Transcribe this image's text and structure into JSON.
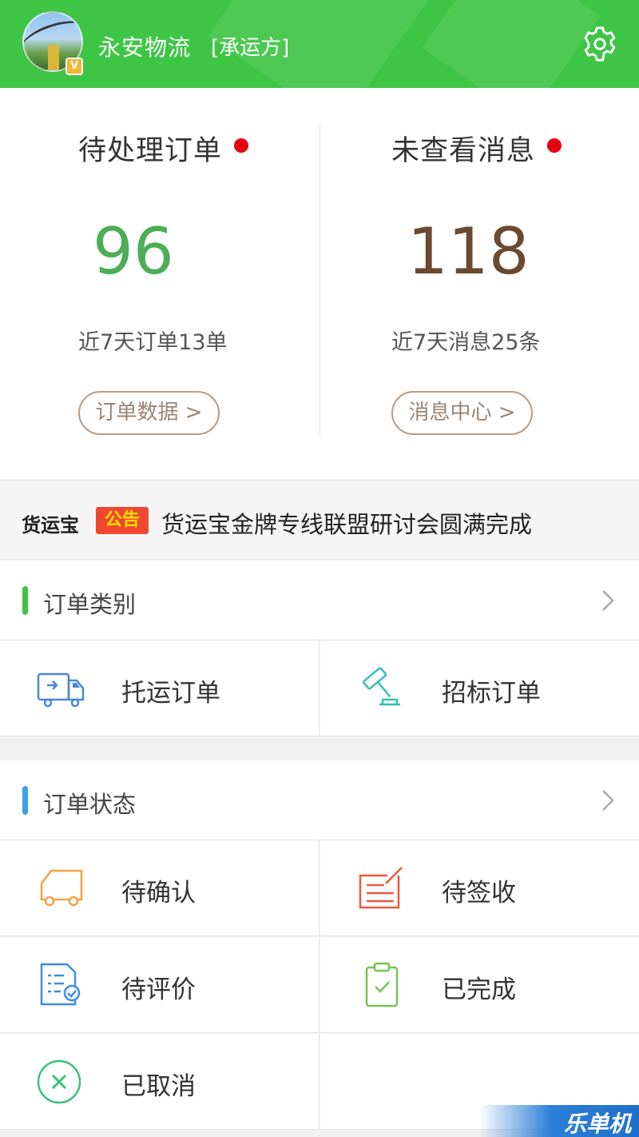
{
  "header": {
    "company_name": "永安物流",
    "role": "[承运方]",
    "badge": "V",
    "settings_icon": "gear-icon",
    "color": "#3ec545"
  },
  "stats": {
    "pending_orders": {
      "title": "待处理订单",
      "value": "96",
      "subtitle": "近7天订单13单",
      "button": "订单数据 >",
      "value_color": "#4cae56"
    },
    "unread_messages": {
      "title": "未查看消息",
      "value": "118",
      "subtitle": "近7天消息25条",
      "button": "消息中心 >",
      "value_color": "#6b4a30"
    },
    "dot_color": "#e60012"
  },
  "notice": {
    "brand": "货运宝",
    "tag": "公告",
    "text": "货运宝金牌专线联盟研讨会圆满完成"
  },
  "order_category": {
    "title": "订单类别",
    "bar_color": "#3ec545",
    "items": [
      {
        "label": "托运订单",
        "icon": "truck-icon"
      },
      {
        "label": "招标订单",
        "icon": "gavel-icon"
      }
    ]
  },
  "order_status": {
    "title": "订单状态",
    "bar_color": "#3aa3e8",
    "items": [
      {
        "label": "待确认",
        "icon": "truck-outline-icon"
      },
      {
        "label": "待签收",
        "icon": "sign-icon"
      },
      {
        "label": "待评价",
        "icon": "review-icon"
      },
      {
        "label": "已完成",
        "icon": "clipboard-check-icon"
      },
      {
        "label": "已取消",
        "icon": "cancel-icon"
      }
    ]
  },
  "watermark": "乐单机"
}
